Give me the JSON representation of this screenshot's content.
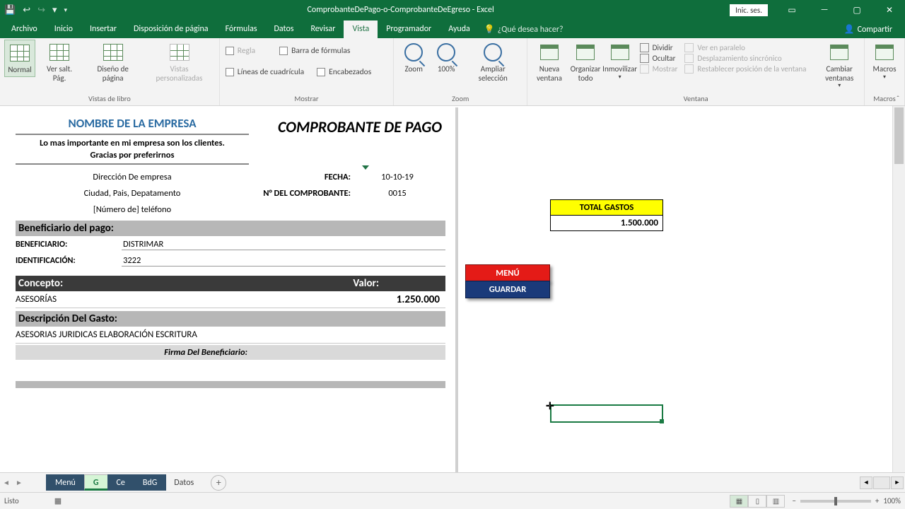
{
  "titlebar": {
    "title": "ComprobanteDePago-o-ComprobanteDeEgreso  -  Excel",
    "signin": "Inic. ses."
  },
  "menu": {
    "tabs": [
      "Archivo",
      "Inicio",
      "Insertar",
      "Disposición de página",
      "Fórmulas",
      "Datos",
      "Revisar",
      "Vista",
      "Programador",
      "Ayuda"
    ],
    "active": 7,
    "tell": "¿Qué desea hacer?",
    "share": "Compartir"
  },
  "ribbon": {
    "views": {
      "normal": "Normal",
      "salto": "Ver salt. Pág.",
      "diseno": "Diseño de página",
      "pers": "Vistas personalizadas",
      "group": "Vistas de libro"
    },
    "show": {
      "regla": "Regla",
      "formulabar": "Barra de fórmulas",
      "grid": "Líneas de cuadrícula",
      "enc": "Encabezados",
      "group": "Mostrar"
    },
    "zoom": {
      "zoom": "Zoom",
      "p100": "100%",
      "sel": "Ampliar selección",
      "group": "Zoom"
    },
    "window": {
      "nueva": "Nueva ventana",
      "org": "Organizar todo",
      "inm": "Inmovilizar",
      "div": "Dividir",
      "oc": "Ocultar",
      "mos": "Mostrar",
      "par": "Ver en paralelo",
      "desp": "Desplazamiento sincrónico",
      "rest": "Restablecer posición de la ventana",
      "camb": "Cambiar ventanas",
      "group": "Ventana"
    },
    "macros": {
      "label": "Macros",
      "group": "Macros"
    }
  },
  "doc": {
    "company": "NOMBRE DE LA EMPRESA",
    "slogan1": "Lo mas importante en mi empresa son los clientes.",
    "slogan2": "Gracias por preferirnos",
    "title": "COMPROBANTE DE PAGO",
    "address": "Dirección De empresa",
    "city": "Ciudad, Pais, Depatamento",
    "phone": "[Número de] teléfono",
    "fecha_lbl": "FECHA:",
    "fecha": "10-10-19",
    "num_lbl": "N° DEL COMPROBANTE:",
    "num": "0015",
    "benef_hdr": "Beneficiario del pago:",
    "benef_lbl": "BENEFICIARIO:",
    "benef": "DISTRIMAR",
    "ident_lbl": "IDENTIFICACIÓN:",
    "ident": "3222",
    "concepto_hdr": "Concepto:",
    "valor_hdr": "Valor:",
    "concepto": "ASESORÍAS",
    "valor": "1.250.000",
    "desc_hdr": "Descripción Del Gasto:",
    "desc": "ASESORIAS JURIDICAS ELABORACIÓN ESCRITURA",
    "firma": "Firma Del Beneficiario:"
  },
  "side": {
    "tot_hdr": "TOTAL GASTOS",
    "tot_val": "1.500.000",
    "menu": "MENÚ",
    "guardar": "GUARDAR"
  },
  "sheets": [
    "Menú",
    "G",
    "Ce",
    "BdG",
    "Datos"
  ],
  "status": {
    "ready": "Listo",
    "zoom": "100%"
  }
}
